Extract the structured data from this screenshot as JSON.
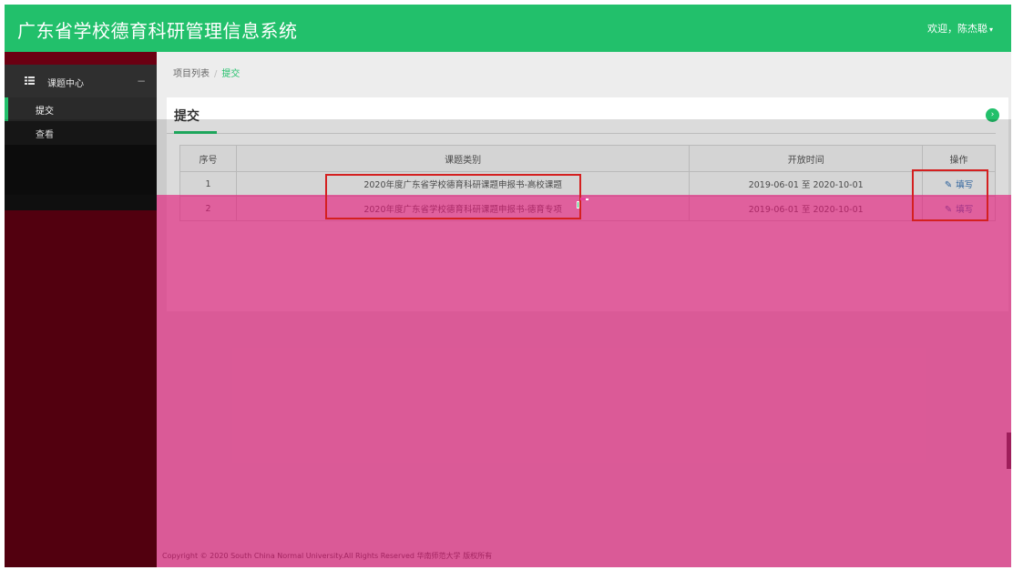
{
  "header": {
    "app_title": "广东省学校德育科研管理信息系统",
    "welcome": "欢迎，陈杰聪",
    "caret": "▾"
  },
  "sidebar": {
    "section_label": "课题中心",
    "section_toggle": "−",
    "items": [
      {
        "label": "提交"
      },
      {
        "label": "查看"
      }
    ]
  },
  "breadcrumb": {
    "parent": "项目列表",
    "separator": "/",
    "current": "提交"
  },
  "panel": {
    "title": "提交",
    "go_icon": "›"
  },
  "table": {
    "headers": [
      "序号",
      "课题类别",
      "开放时间",
      "操作"
    ],
    "rows": [
      {
        "index": "1",
        "category": "2020年度广东省学校德育科研课题申报书-高校课题",
        "period": "2019-06-01 至 2020-10-01",
        "action": "填写"
      },
      {
        "index": "2",
        "category": "2020年度广东省学校德育科研课题申报书-德育专项",
        "period": "2019-06-01 至 2020-10-01",
        "action": "填写"
      }
    ],
    "edit_icon": "edit-icon"
  },
  "footer": {
    "copyright": "Copyright © 2020 South China Normal University.All Rights Reserved 华南师范大学 版权所有"
  },
  "colors": {
    "brand_green": "#22c06b",
    "highlight_red": "#d42020",
    "overlay_pink": "#d2146e"
  }
}
